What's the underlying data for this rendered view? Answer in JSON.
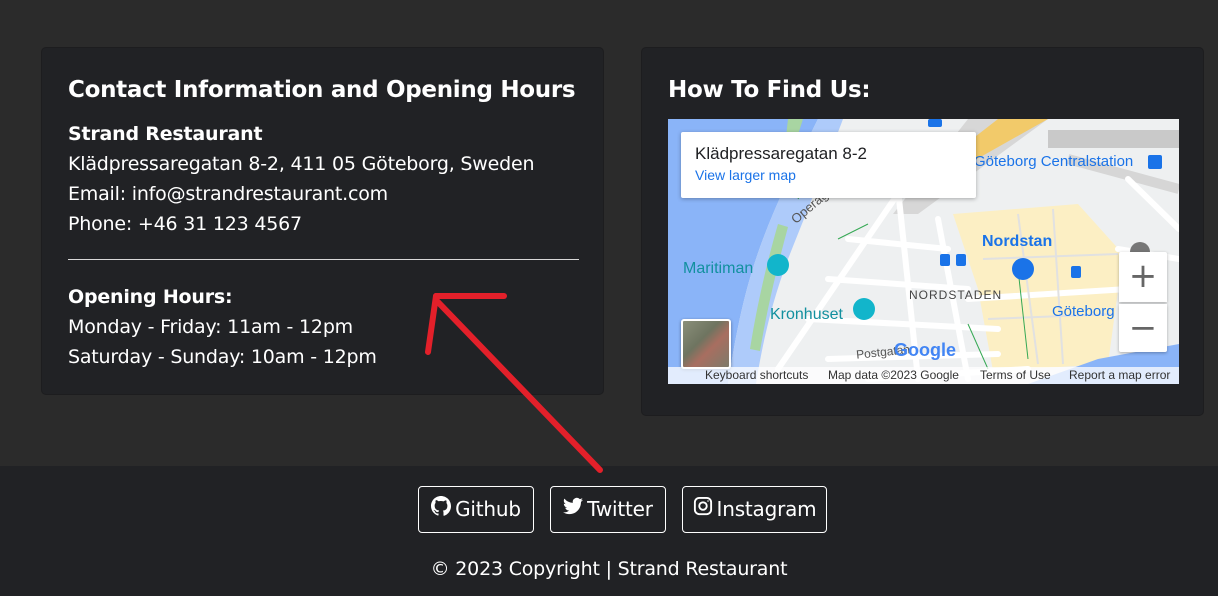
{
  "contact": {
    "heading": "Contact Information and Opening Hours",
    "name": "Strand Restaurant",
    "address": "Klädpressaregatan 8-2, 411 05 Göteborg, Sweden",
    "email": "Email: info@strandrestaurant.com",
    "phone": "Phone: +46 31 123 4567",
    "hours_heading": "Opening Hours:",
    "hours_weekday": "Monday - Friday: 11am - 12pm",
    "hours_weekend": "Saturday - Sunday: 10am - 12pm"
  },
  "find_us": {
    "heading": "How To Find Us:",
    "map": {
      "infobox_title": "Klädpressaregatan 8-2",
      "infobox_link": "View larger map",
      "labels": {
        "centralstation": "Göteborg Centralstation",
        "nordstan": "Nordstan",
        "maritiman": "Maritiman",
        "operagatan": "Operagatan",
        "nordstaden": "NORDSTADEN",
        "kronhuset": "Kronhuset",
        "goteborg": "Göteborg",
        "postgatan": "Postgatan",
        "google": "Google"
      },
      "zoom_in": "+",
      "zoom_out": "−",
      "attribution": {
        "shortcuts": "Keyboard shortcuts",
        "map_data": "Map data ©2023 Google",
        "terms": "Terms of Use",
        "report": "Report a map error"
      }
    }
  },
  "footer": {
    "github": "Github",
    "twitter": "Twitter",
    "instagram": "Instagram",
    "copyright": "© 2023 Copyright | Strand Restaurant"
  },
  "colors": {
    "page_bg": "#2b2b2b",
    "card_bg": "#212225",
    "annotation_arrow": "#e3202a"
  },
  "icons": [
    "github-icon",
    "twitter-icon",
    "instagram-icon"
  ]
}
